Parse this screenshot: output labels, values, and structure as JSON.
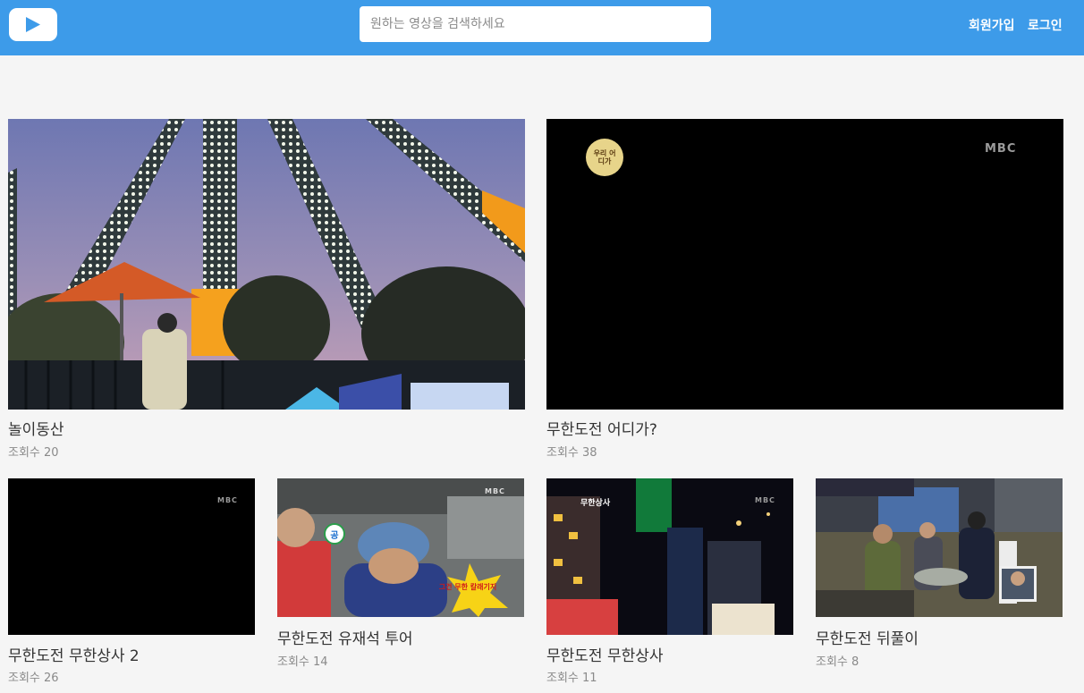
{
  "header": {
    "logo_icon": "play-icon",
    "search_placeholder": "원하는 영상을 검색하세요",
    "signup_label": "회원가입",
    "login_label": "로그인",
    "bg_color": "#3d9be9"
  },
  "videos": [
    {
      "title": "놀이동산",
      "views": "조회수 20"
    },
    {
      "title": "무한도전 어디가?",
      "views": "조회수 38"
    },
    {
      "title": "무한도전 무한상사 2",
      "views": "조회수 26"
    },
    {
      "title": "무한도전 유재석 투어",
      "views": "조회수 14"
    },
    {
      "title": "무한도전 무한상사",
      "views": "조회수 11"
    },
    {
      "title": "무한도전 뒤풀이",
      "views": "조회수 8"
    }
  ],
  "thumb_badges": {
    "mbc": "MBC",
    "yuri": "우리 어디가",
    "gong": "공",
    "caption": "그건 무한 칼래기지",
    "show_logo": "무한상사"
  }
}
